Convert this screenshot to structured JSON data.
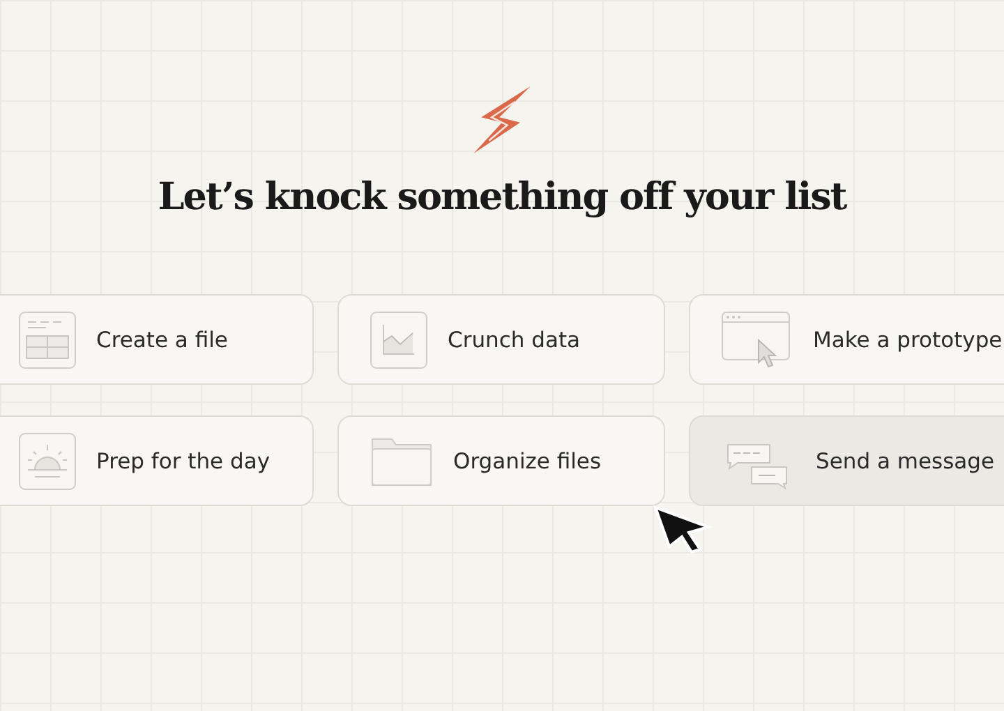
{
  "heading": "Let’s knock something off your list",
  "actions": [
    {
      "label": "Create a file",
      "kind": "file",
      "selected": false
    },
    {
      "label": "Crunch data",
      "kind": "data",
      "selected": false
    },
    {
      "label": "Make a prototype",
      "kind": "prototype",
      "selected": false
    },
    {
      "label": "Prep for the day",
      "kind": "day",
      "selected": false
    },
    {
      "label": "Organize files",
      "kind": "folder",
      "selected": false
    },
    {
      "label": "Send a message",
      "kind": "message",
      "selected": true
    }
  ]
}
